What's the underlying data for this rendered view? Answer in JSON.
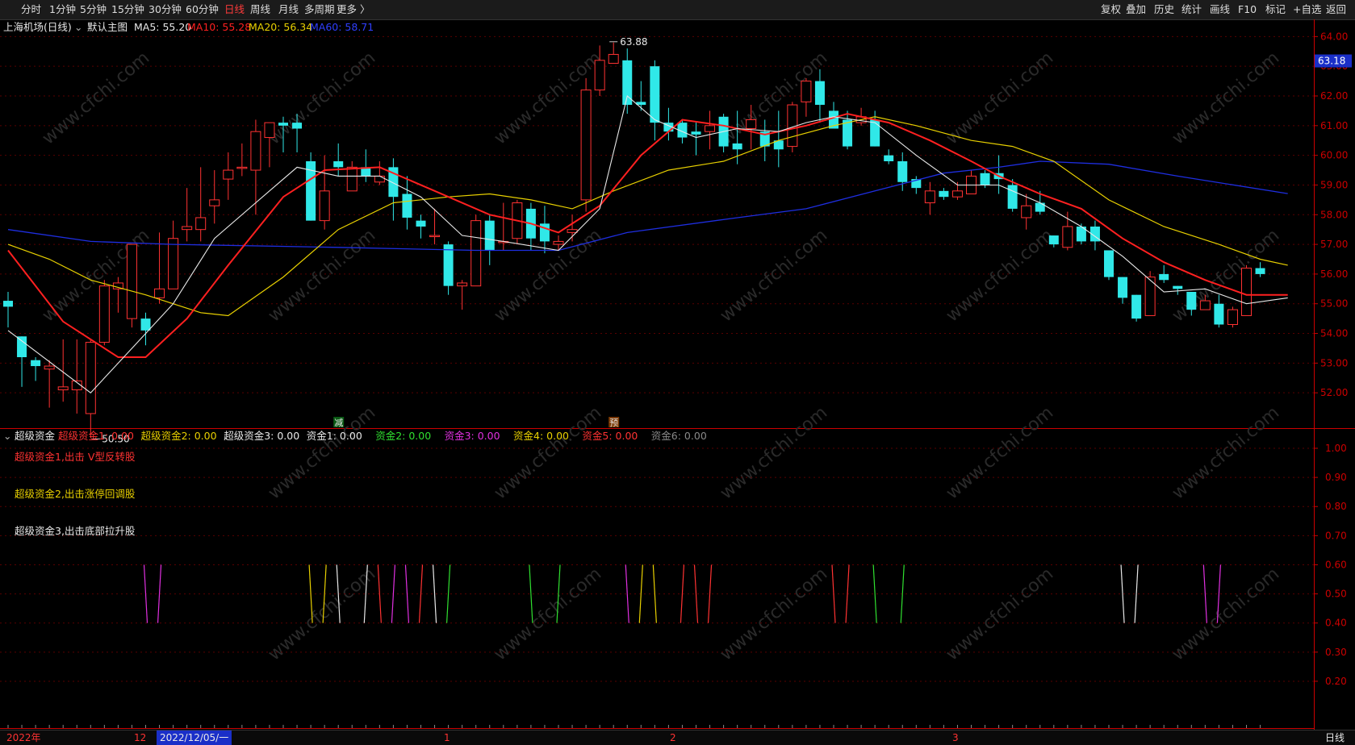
{
  "toolbar": {
    "periods": [
      "分时",
      "1分钟",
      "5分钟",
      "15分钟",
      "30分钟",
      "60分钟",
      "日线",
      "周线",
      "月线",
      "多周期",
      "更多 〉"
    ],
    "active_period": "日线",
    "tools": [
      "复权",
      "叠加",
      "历史",
      "统计",
      "画线",
      "F10",
      "标记",
      "+自选",
      "返回"
    ]
  },
  "legend": {
    "stock": "上海机场(日线)",
    "template": "默认主图",
    "ma5": "MA5: 55.20",
    "ma10": "MA10: 55.28",
    "ma20": "MA20: 56.34",
    "ma60": "MA60: 58.71"
  },
  "colors": {
    "up": "#ff3232",
    "down": "#30e8e8",
    "ma5": "#e8e8e8",
    "ma10": "#ff2020",
    "ma20": "#e8d000",
    "ma60": "#1e2ee0",
    "grid": "#5a0000",
    "axis": "#cc0000"
  },
  "price_axis": {
    "ticks": [
      "64.00",
      "63.00",
      "62.00",
      "61.00",
      "60.00",
      "59.00",
      "58.00",
      "57.00",
      "56.00",
      "55.00",
      "54.00",
      "53.00",
      "52.00"
    ],
    "current": "63.18"
  },
  "annotations": {
    "high": "63.88",
    "low": "50.50",
    "marker1": "减",
    "marker2": "预"
  },
  "indicator": {
    "title": "超级资金",
    "fields": [
      {
        "label": "超级资金1: 0.00",
        "color": "#ff3232"
      },
      {
        "label": "超级资金2: 0.00",
        "color": "#e8d000"
      },
      {
        "label": "超级资金3: 0.00",
        "color": "#e8e8e8"
      },
      {
        "label": "资金1: 0.00",
        "color": "#e8e8e8"
      },
      {
        "label": "资金2: 0.00",
        "color": "#30e030"
      },
      {
        "label": "资金3: 0.00",
        "color": "#e030e0"
      },
      {
        "label": "资金4: 0.00",
        "color": "#e8d000"
      },
      {
        "label": "资金5: 0.00",
        "color": "#ff3232"
      },
      {
        "label": "资金6: 0.00",
        "color": "#888888"
      }
    ],
    "notes": [
      {
        "text": "超级资金1,出击 V型反转股",
        "color": "#ff3232"
      },
      {
        "text": "超级资金2,出击涨停回调股",
        "color": "#e8d000"
      },
      {
        "text": "超级资金3,出击底部拉升股",
        "color": "#e8e8e8"
      }
    ],
    "axis_ticks": [
      "1.00",
      "0.90",
      "0.80",
      "0.70",
      "0.60",
      "0.50",
      "0.40",
      "0.30",
      "0.20"
    ]
  },
  "datebar": {
    "year": "2022年",
    "m12": "12",
    "cursor_date": "2022/12/05/一",
    "m1": "1",
    "m2": "2",
    "m3": "3",
    "mode": "日线"
  },
  "watermark": "www.cfchi.com",
  "chart_data": {
    "type": "candlestick",
    "ylim": [
      51,
      64.2
    ],
    "candles": [
      [
        55.1,
        54.9,
        55.4,
        54.2
      ],
      [
        53.9,
        53.2,
        53.9,
        52.2
      ],
      [
        53.1,
        52.9,
        53.2,
        52.4
      ],
      [
        52.8,
        52.9,
        53.1,
        51.5
      ],
      [
        52.1,
        52.2,
        53.8,
        51.7
      ],
      [
        52.1,
        52.4,
        53.8,
        51.3
      ],
      [
        51.3,
        53.7,
        53.8,
        50.5
      ],
      [
        53.7,
        55.6,
        55.8,
        53.6
      ],
      [
        55.5,
        55.7,
        55.9,
        54.7
      ],
      [
        54.5,
        57.0,
        57.0,
        54.2
      ],
      [
        54.5,
        54.1,
        54.7,
        53.6
      ],
      [
        55.2,
        55.5,
        57.4,
        55.0
      ],
      [
        55.5,
        57.2,
        57.8,
        55.5
      ],
      [
        57.5,
        57.6,
        58.9,
        57.1
      ],
      [
        57.5,
        57.9,
        59.6,
        57.1
      ],
      [
        58.3,
        58.5,
        59.5,
        57.7
      ],
      [
        59.2,
        59.5,
        60.1,
        58.5
      ],
      [
        59.6,
        59.6,
        60.4,
        59.3
      ],
      [
        59.5,
        60.8,
        61.2,
        58.0
      ],
      [
        60.6,
        61.1,
        61.1,
        59.6
      ],
      [
        61.1,
        61.0,
        61.3,
        60.1
      ],
      [
        61.1,
        60.9,
        61.4,
        60.1
      ],
      [
        59.8,
        57.8,
        60.1,
        57.8
      ],
      [
        57.8,
        58.8,
        60.0,
        57.5
      ],
      [
        59.8,
        59.6,
        60.4,
        59.3
      ],
      [
        58.8,
        59.6,
        59.8,
        58.8
      ],
      [
        59.6,
        59.3,
        60.2,
        59.1
      ],
      [
        59.1,
        59.3,
        59.8,
        59.0
      ],
      [
        59.6,
        58.6,
        59.9,
        57.8
      ],
      [
        58.7,
        57.9,
        59.3,
        57.5
      ],
      [
        57.8,
        57.6,
        58.0,
        57.2
      ],
      [
        57.3,
        57.3,
        58.2,
        57.0
      ],
      [
        57.0,
        55.6,
        57.1,
        55.3
      ],
      [
        55.6,
        55.7,
        55.8,
        54.8
      ],
      [
        55.6,
        57.8,
        58.0,
        55.6
      ],
      [
        57.8,
        56.8,
        58.0,
        56.3
      ],
      [
        57.1,
        57.1,
        58.4,
        56.8
      ],
      [
        57.2,
        58.4,
        58.5,
        57.0
      ],
      [
        58.2,
        57.2,
        58.4,
        56.8
      ],
      [
        57.7,
        57.1,
        58.3,
        56.7
      ],
      [
        57.0,
        57.1,
        57.3,
        56.8
      ],
      [
        57.4,
        57.5,
        58.0,
        57.1
      ],
      [
        58.5,
        62.2,
        62.6,
        58.1
      ],
      [
        62.2,
        63.2,
        63.7,
        62.0
      ],
      [
        63.1,
        63.4,
        63.8,
        63.1
      ],
      [
        63.2,
        61.7,
        63.6,
        61.4
      ],
      [
        61.8,
        61.7,
        62.5,
        61.5
      ],
      [
        63.0,
        61.1,
        63.2,
        60.5
      ],
      [
        61.1,
        60.8,
        61.6,
        60.5
      ],
      [
        61.1,
        60.6,
        61.2,
        60.4
      ],
      [
        60.8,
        60.7,
        61.1,
        60.0
      ],
      [
        60.8,
        61.0,
        61.5,
        60.2
      ],
      [
        61.3,
        60.3,
        61.4,
        60.1
      ],
      [
        60.4,
        60.2,
        61.5,
        59.7
      ],
      [
        60.9,
        61.2,
        61.7,
        60.2
      ],
      [
        60.8,
        60.3,
        61.2,
        59.8
      ],
      [
        60.5,
        60.2,
        61.5,
        59.6
      ],
      [
        60.3,
        61.7,
        61.8,
        60.1
      ],
      [
        61.8,
        62.5,
        62.6,
        61.3
      ],
      [
        62.5,
        61.7,
        62.9,
        61.1
      ],
      [
        61.5,
        60.9,
        61.8,
        60.9
      ],
      [
        61.2,
        60.3,
        61.5,
        60.2
      ],
      [
        61.1,
        61.3,
        61.6,
        61.0
      ],
      [
        61.2,
        60.3,
        61.5,
        60.3
      ],
      [
        60.0,
        59.8,
        60.2,
        59.7
      ],
      [
        59.8,
        59.1,
        60.1,
        58.8
      ],
      [
        59.2,
        58.9,
        59.3,
        58.7
      ],
      [
        58.4,
        58.8,
        59.1,
        58.0
      ],
      [
        58.8,
        58.6,
        58.9,
        58.5
      ],
      [
        58.6,
        58.8,
        59.1,
        58.5
      ],
      [
        58.7,
        59.3,
        59.5,
        58.7
      ],
      [
        59.4,
        59.0,
        59.5,
        58.9
      ],
      [
        59.4,
        59.2,
        60.0,
        58.7
      ],
      [
        59.0,
        58.2,
        59.2,
        58.1
      ],
      [
        57.9,
        58.3,
        58.7,
        57.5
      ],
      [
        58.4,
        58.1,
        58.8,
        58.0
      ],
      [
        57.3,
        57.0,
        57.3,
        56.9
      ],
      [
        56.9,
        57.6,
        58.1,
        56.8
      ],
      [
        57.6,
        57.1,
        57.7,
        57.0
      ],
      [
        57.6,
        57.1,
        57.8,
        56.8
      ],
      [
        56.8,
        55.9,
        56.8,
        55.8
      ],
      [
        55.9,
        55.2,
        55.9,
        55.0
      ],
      [
        55.3,
        54.5,
        55.3,
        54.4
      ],
      [
        54.6,
        55.9,
        56.1,
        54.6
      ],
      [
        56.0,
        55.8,
        56.3,
        55.7
      ],
      [
        55.6,
        55.5,
        55.6,
        55.3
      ],
      [
        55.4,
        54.8,
        55.4,
        54.6
      ],
      [
        54.8,
        55.1,
        55.3,
        54.8
      ],
      [
        55.0,
        54.3,
        55.3,
        54.2
      ],
      [
        54.3,
        54.8,
        54.9,
        54.2
      ],
      [
        54.6,
        56.2,
        56.3,
        54.6
      ],
      [
        56.2,
        56.0,
        56.4,
        55.9
      ]
    ],
    "ma5": [
      [
        0,
        54.1
      ],
      [
        6,
        52.0
      ],
      [
        9,
        53.5
      ],
      [
        12,
        55.0
      ],
      [
        15,
        57.2
      ],
      [
        19,
        58.8
      ],
      [
        21,
        59.6
      ],
      [
        24,
        59.3
      ],
      [
        27,
        59.3
      ],
      [
        30,
        58.6
      ],
      [
        33,
        57.3
      ],
      [
        36,
        57.1
      ],
      [
        40,
        56.8
      ],
      [
        43,
        58.2
      ],
      [
        45,
        62.0
      ],
      [
        47,
        61.2
      ],
      [
        50,
        60.6
      ],
      [
        53,
        60.9
      ],
      [
        56,
        60.8
      ],
      [
        58,
        61.1
      ],
      [
        60,
        61.3
      ],
      [
        63,
        61.1
      ],
      [
        66,
        60.0
      ],
      [
        69,
        59.0
      ],
      [
        72,
        59.0
      ],
      [
        75,
        58.4
      ],
      [
        78,
        57.6
      ],
      [
        81,
        56.6
      ],
      [
        84,
        55.4
      ],
      [
        87,
        55.5
      ],
      [
        90,
        55.0
      ],
      [
        93,
        55.2
      ]
    ],
    "ma10": [
      [
        0,
        56.8
      ],
      [
        4,
        54.4
      ],
      [
        8,
        53.2
      ],
      [
        10,
        53.2
      ],
      [
        13,
        54.5
      ],
      [
        16,
        56.3
      ],
      [
        20,
        58.6
      ],
      [
        23,
        59.5
      ],
      [
        27,
        59.6
      ],
      [
        31,
        58.8
      ],
      [
        35,
        58.0
      ],
      [
        38,
        57.7
      ],
      [
        40,
        57.4
      ],
      [
        43,
        58.3
      ],
      [
        46,
        60.0
      ],
      [
        49,
        61.2
      ],
      [
        52,
        61.0
      ],
      [
        55,
        60.7
      ],
      [
        58,
        61.0
      ],
      [
        61,
        61.4
      ],
      [
        64,
        61.1
      ],
      [
        67,
        60.5
      ],
      [
        70,
        59.8
      ],
      [
        72,
        59.3
      ],
      [
        75,
        58.7
      ],
      [
        78,
        58.2
      ],
      [
        81,
        57.2
      ],
      [
        84,
        56.4
      ],
      [
        87,
        55.8
      ],
      [
        90,
        55.3
      ],
      [
        93,
        55.3
      ]
    ],
    "ma20": [
      [
        0,
        57.0
      ],
      [
        3,
        56.5
      ],
      [
        6,
        55.8
      ],
      [
        10,
        55.3
      ],
      [
        14,
        54.7
      ],
      [
        16,
        54.6
      ],
      [
        20,
        55.9
      ],
      [
        24,
        57.5
      ],
      [
        28,
        58.4
      ],
      [
        32,
        58.6
      ],
      [
        35,
        58.7
      ],
      [
        38,
        58.5
      ],
      [
        41,
        58.2
      ],
      [
        44,
        58.8
      ],
      [
        48,
        59.5
      ],
      [
        52,
        59.8
      ],
      [
        56,
        60.5
      ],
      [
        60,
        61.0
      ],
      [
        63,
        61.3
      ],
      [
        66,
        61.0
      ],
      [
        70,
        60.5
      ],
      [
        73,
        60.3
      ],
      [
        76,
        59.8
      ],
      [
        80,
        58.5
      ],
      [
        84,
        57.6
      ],
      [
        88,
        57.0
      ],
      [
        91,
        56.5
      ],
      [
        93,
        56.3
      ]
    ],
    "ma60": [
      [
        0,
        57.5
      ],
      [
        6,
        57.1
      ],
      [
        12,
        57.0
      ],
      [
        24,
        56.9
      ],
      [
        34,
        56.8
      ],
      [
        40,
        56.8
      ],
      [
        45,
        57.4
      ],
      [
        53,
        57.9
      ],
      [
        58,
        58.2
      ],
      [
        63,
        58.8
      ],
      [
        68,
        59.4
      ],
      [
        72,
        59.6
      ],
      [
        75,
        59.8
      ],
      [
        80,
        59.7
      ],
      [
        85,
        59.3
      ],
      [
        93,
        58.71
      ]
    ],
    "signals": [
      {
        "i": 10,
        "c": "#e030e0"
      },
      {
        "i": 11,
        "c": "#e030e0"
      },
      {
        "i": 22,
        "c": "#e8d000"
      },
      {
        "i": 23,
        "c": "#e8d000"
      },
      {
        "i": 24,
        "c": "#e8e8e8"
      },
      {
        "i": 26,
        "c": "#e8e8e8"
      },
      {
        "i": 27,
        "c": "#ff3232"
      },
      {
        "i": 28,
        "c": "#e030e0"
      },
      {
        "i": 29,
        "c": "#e030e0"
      },
      {
        "i": 30,
        "c": "#ff3232"
      },
      {
        "i": 31,
        "c": "#e8e8e8"
      },
      {
        "i": 32,
        "c": "#30e030"
      },
      {
        "i": 38,
        "c": "#30e030"
      },
      {
        "i": 40,
        "c": "#30e030"
      },
      {
        "i": 45,
        "c": "#e030e0"
      },
      {
        "i": 46,
        "c": "#e8d000"
      },
      {
        "i": 47,
        "c": "#e8d000"
      },
      {
        "i": 49,
        "c": "#ff3232"
      },
      {
        "i": 50,
        "c": "#ff3232"
      },
      {
        "i": 51,
        "c": "#ff3232"
      },
      {
        "i": 60,
        "c": "#ff3232"
      },
      {
        "i": 61,
        "c": "#ff3232"
      },
      {
        "i": 63,
        "c": "#30e030"
      },
      {
        "i": 65,
        "c": "#30e030"
      },
      {
        "i": 81,
        "c": "#e8e8e8"
      },
      {
        "i": 82,
        "c": "#e8e8e8"
      },
      {
        "i": 87,
        "c": "#e030e0"
      },
      {
        "i": 88,
        "c": "#e030e0"
      }
    ]
  }
}
